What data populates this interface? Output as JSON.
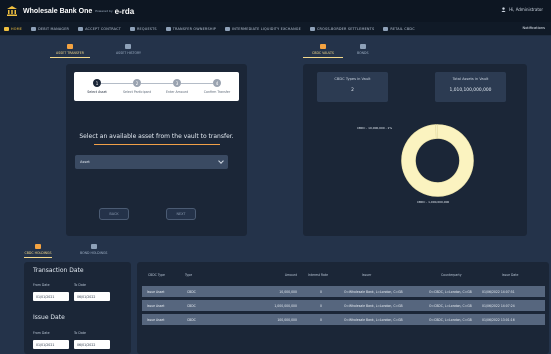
{
  "app": {
    "brand": "Wholesale Bank One",
    "powered_by": "Powered by",
    "brand_logo": "e-rda",
    "user": "Hi, Administrator",
    "notifications": "Notifications"
  },
  "nav": [
    {
      "label": "Home",
      "icon": "home-icon",
      "active": true
    },
    {
      "label": "DEBIT MANAGER",
      "icon": "list-icon"
    },
    {
      "label": "ACCEPT CONTRACT",
      "icon": "contract-icon"
    },
    {
      "label": "REQUESTS",
      "icon": "phone-icon"
    },
    {
      "label": "TRANSFER OWNERSHIP",
      "icon": "transfer-icon"
    },
    {
      "label": "INTERMEDIATE LIQUIDITY EXCHANGE",
      "icon": "exchange-icon"
    },
    {
      "label": "CROSS-BORDER SETTLEMENTS",
      "icon": "document-icon"
    },
    {
      "label": "RETAIL CBDC",
      "icon": "bank-icon"
    }
  ],
  "top_tabs_left": [
    {
      "label": "ASSET TRANSFER",
      "active": true
    },
    {
      "label": "ASSET HISTORY",
      "active": false
    }
  ],
  "top_tabs_right": [
    {
      "label": "CBDC VAULTS",
      "active": true
    },
    {
      "label": "BONDS",
      "active": false
    }
  ],
  "stepper": {
    "steps": [
      {
        "num": "1",
        "label": "Select Asset",
        "active": true
      },
      {
        "num": "2",
        "label": "Select Participant",
        "active": false
      },
      {
        "num": "3",
        "label": "Enter Amount",
        "active": false
      },
      {
        "num": "4",
        "label": "Confirm Transfer",
        "active": false
      }
    ],
    "prompt": "Select an available asset from the vault to transfer.",
    "select_placeholder": "Asset",
    "back_label": "BACK",
    "next_label": "NEXT"
  },
  "vault": {
    "types_label": "CBDC Types in Vault",
    "types_value": "2",
    "total_label": "Total Assets in Vault",
    "total_value": "1,010,100,000,000"
  },
  "chart_data": {
    "type": "pie",
    "donut": true,
    "labels": [
      "CBDC - 10,000,000 - 1%",
      "CBDC - 1,000,000,000"
    ],
    "values": [
      10000000,
      1000000000
    ],
    "colors": [
      "#f6efc4",
      "#fbf3c0"
    ]
  },
  "lower_tabs": [
    {
      "label": "CBDC HOLDINGS",
      "active": true
    },
    {
      "label": "BOND HOLDINGS",
      "active": false
    }
  ],
  "filters": {
    "txn_title": "Transaction Date",
    "from_label": "From Date",
    "to_label": "To Date",
    "txn_from": "01/01/2021",
    "txn_to": "06/01/2022",
    "issue_title": "Issue Date",
    "issue_from": "01/01/2021",
    "issue_to": "06/01/2022"
  },
  "table": {
    "headers": [
      "CBDC Type",
      "Type",
      "Amount",
      "Interest Rate",
      "Issuer",
      "Counterparty",
      "Issue Date"
    ],
    "rows": [
      [
        "Issue Asset",
        "CBDC",
        "10,000,000",
        "0",
        "O=Wholesale Bank, L=London, C=GB",
        "O=CBDC, L=London, C=GB",
        "01/06/2022 14:07:51"
      ],
      [
        "Issue Asset",
        "CBDC",
        "1,000,000,000",
        "0",
        "O=Wholesale Bank, L=London, C=GB",
        "O=CBDC, L=London, C=GB",
        "01/06/2022 14:07:24"
      ],
      [
        "Issue Asset",
        "CBDC",
        "100,000,000",
        "0",
        "O=Wholesale Bank, L=London, C=GB",
        "O=CBDC, L=London, C=GB",
        "01/06/2022 13:01:16"
      ]
    ]
  }
}
